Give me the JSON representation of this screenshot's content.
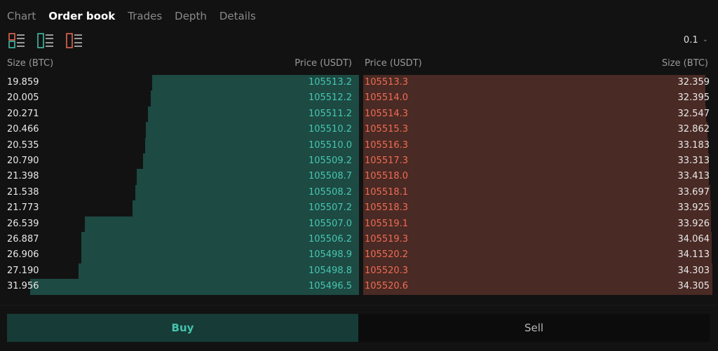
{
  "tabs": [
    {
      "label": "Chart",
      "active": false
    },
    {
      "label": "Order book",
      "active": true
    },
    {
      "label": "Trades",
      "active": false
    },
    {
      "label": "Depth",
      "active": false
    },
    {
      "label": "Details",
      "active": false
    }
  ],
  "view_modes": [
    {
      "icon": "orderbook-both-icon",
      "colors": [
        "#46c6b0",
        "#f06c55"
      ]
    },
    {
      "icon": "orderbook-bids-icon",
      "colors": [
        "#46c6b0"
      ]
    },
    {
      "icon": "orderbook-asks-icon",
      "colors": [
        "#f06c55"
      ]
    }
  ],
  "precision": {
    "value": "0.1",
    "icon": "chevron-down-icon"
  },
  "headers": {
    "bid_size": "Size (BTC)",
    "bid_price": "Price (USDT)",
    "ask_price": "Price (USDT)",
    "ask_size": "Size (BTC)"
  },
  "bids": [
    {
      "size": "19.859",
      "price": "105513.2"
    },
    {
      "size": "20.005",
      "price": "105512.2"
    },
    {
      "size": "20.271",
      "price": "105511.2"
    },
    {
      "size": "20.466",
      "price": "105510.2"
    },
    {
      "size": "20.535",
      "price": "105510.0"
    },
    {
      "size": "20.790",
      "price": "105509.2"
    },
    {
      "size": "21.398",
      "price": "105508.7"
    },
    {
      "size": "21.538",
      "price": "105508.2"
    },
    {
      "size": "21.773",
      "price": "105507.2"
    },
    {
      "size": "26.539",
      "price": "105507.0"
    },
    {
      "size": "26.887",
      "price": "105506.2"
    },
    {
      "size": "26.906",
      "price": "105498.9"
    },
    {
      "size": "27.190",
      "price": "105498.8"
    },
    {
      "size": "31.956",
      "price": "105496.5"
    }
  ],
  "asks": [
    {
      "price": "105513.3",
      "size": "32.359"
    },
    {
      "price": "105514.0",
      "size": "32.395"
    },
    {
      "price": "105514.3",
      "size": "32.547"
    },
    {
      "price": "105515.3",
      "size": "32.862"
    },
    {
      "price": "105516.3",
      "size": "33.183"
    },
    {
      "price": "105517.3",
      "size": "33.313"
    },
    {
      "price": "105518.0",
      "size": "33.413"
    },
    {
      "price": "105518.1",
      "size": "33.697"
    },
    {
      "price": "105518.3",
      "size": "33.925"
    },
    {
      "price": "105519.1",
      "size": "33.926"
    },
    {
      "price": "105519.3",
      "size": "34.064"
    },
    {
      "price": "105520.2",
      "size": "34.113"
    },
    {
      "price": "105520.3",
      "size": "34.303"
    },
    {
      "price": "105520.6",
      "size": "34.305"
    }
  ],
  "buttons": {
    "buy": "Buy",
    "sell": "Sell"
  },
  "colors": {
    "bid": "#46c6b0",
    "ask": "#f06c55",
    "bid_depth": "#1d4a43",
    "ask_depth": "#4a2a24",
    "background": "#121212"
  }
}
